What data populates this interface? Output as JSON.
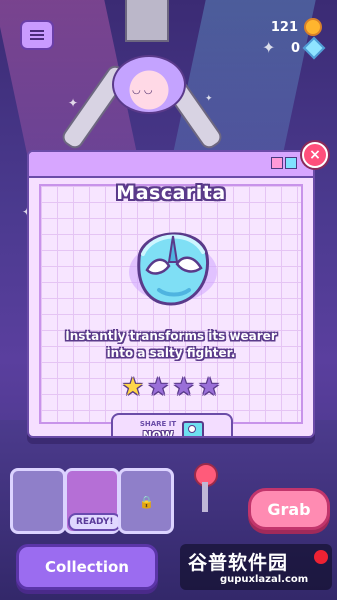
{
  "hud": {
    "coins": "121",
    "gems": "0",
    "coin_icon": "coin-icon",
    "gem_icon": "gem-icon",
    "menu_icon": "menu-icon"
  },
  "modal": {
    "item_name": "Mascarita",
    "description_line1": "Instantly transforms its wearer",
    "description_line2": "into a salty fighter.",
    "rating": 1,
    "rating_max": 4,
    "share_top": "SHARE IT",
    "share_bottom": "NOW",
    "close_label": "×",
    "colors": {
      "panel": "#f6dfff",
      "titlebar": "#d7a6ff",
      "outline": "#6b4ca8",
      "star_on": "#ffd54a",
      "star_off": "#9a6fd8"
    }
  },
  "machine": {
    "ready_label": "READY!",
    "grab_label": "Grab",
    "collection_label": "Collection"
  },
  "watermark": {
    "text_cn": "谷普软件园",
    "url": "gupuxlazal.com"
  }
}
